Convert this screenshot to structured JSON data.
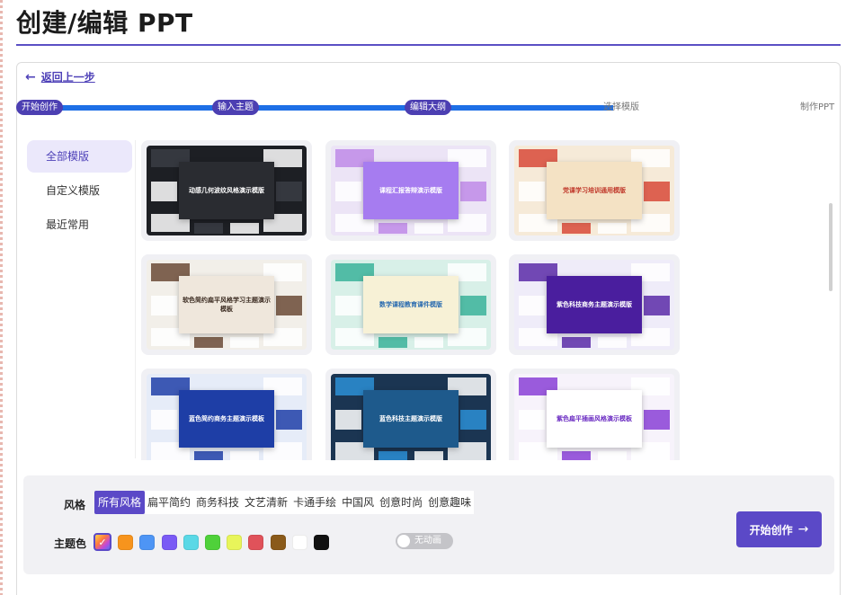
{
  "page": {
    "title": "创建/编辑 PPT"
  },
  "nav": {
    "back_label": "返回上一步",
    "back_icon": "arrow-left-icon"
  },
  "progress": {
    "steps": [
      {
        "label": "开始创作",
        "state": "done"
      },
      {
        "label": "输入主题",
        "state": "done"
      },
      {
        "label": "编辑大纲",
        "state": "done"
      },
      {
        "label": "选择模版",
        "state": "current"
      },
      {
        "label": "制作PPT",
        "state": "todo"
      }
    ],
    "fill_fraction": 0.71,
    "bar_color": "#1e6fe6"
  },
  "sidebar": {
    "items": [
      {
        "label": "全部模版",
        "active": true
      },
      {
        "label": "自定义模版",
        "active": false
      },
      {
        "label": "最近常用",
        "active": false
      }
    ]
  },
  "templates": [
    {
      "title": "动感几何波纹风格演示模版",
      "bg": "#1d1f24",
      "accent": "#3a3d44",
      "center_bg": "#2a2c31",
      "center_color": "#ffffff"
    },
    {
      "title": "课程汇报答辩演示模版",
      "bg": "#ece4f6",
      "accent": "#c08be8",
      "center_bg": "#a67cf0",
      "center_color": "#ffffff"
    },
    {
      "title": "党课学习培训通用模版",
      "bg": "#f6ead8",
      "accent": "#d84a3a",
      "center_bg": "#f4e2c4",
      "center_color": "#c0392b"
    },
    {
      "title": "软色简约扁平风格学习主题演示模板",
      "bg": "#f2efe9",
      "accent": "#6b4a36",
      "center_bg": "#efe7dc",
      "center_color": "#3c2c22"
    },
    {
      "title": "数学课程教育课件模版",
      "bg": "#d8f0e8",
      "accent": "#3bb39a",
      "center_bg": "#f7f1d6",
      "center_color": "#2b6cb0"
    },
    {
      "title": "紫色科技商务主题演示模版",
      "bg": "#efecf9",
      "accent": "#5b2ca8",
      "center_bg": "#4a1e9e",
      "center_color": "#ffffff"
    },
    {
      "title": "蓝色简约商务主题演示模板",
      "bg": "#e6ecf8",
      "accent": "#1f3fa8",
      "center_bg": "#1e3ea6",
      "center_color": "#ffffff"
    },
    {
      "title": "蓝色科技主题演示模版",
      "bg": "#1b3552",
      "accent": "#2b8fd6",
      "center_bg": "#1e5a8c",
      "center_color": "#ffffff"
    },
    {
      "title": "紫色扁平插画风格演示模板",
      "bg": "#f7f3fb",
      "accent": "#8a3fd6",
      "center_bg": "#ffffff",
      "center_color": "#6a2bc2"
    }
  ],
  "styles": {
    "label": "风格",
    "options": [
      "所有风格",
      "扁平简约",
      "商务科技",
      "文艺清新",
      "卡通手绘",
      "中国风",
      "创意时尚",
      "创意趣味"
    ],
    "selected": "所有风格"
  },
  "colors": {
    "label": "主题色",
    "selected_icon": "check-icon",
    "swatches": [
      "#f7941d",
      "#4e95f5",
      "#7a5af5",
      "#5ad8e6",
      "#4fd13a",
      "#e8f55a",
      "#e0525a",
      "#8a5a1a",
      "#ffffff",
      "#111111"
    ]
  },
  "animation_toggle": {
    "label": "无动画",
    "on": false
  },
  "start_button": {
    "label": "开始创作",
    "icon": "arrow-right-icon"
  }
}
